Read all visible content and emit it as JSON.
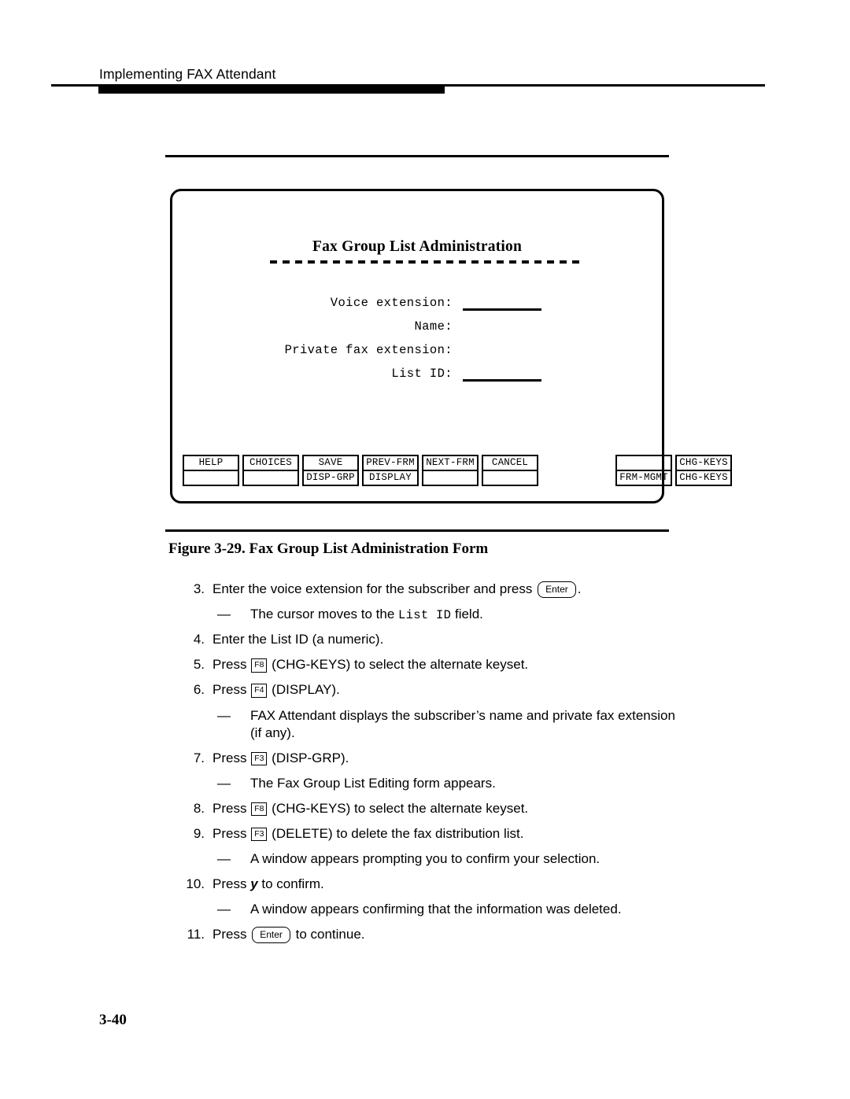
{
  "header": {
    "running_head": "Implementing FAX Attendant"
  },
  "figure": {
    "screen": {
      "title": "Fax Group List Administration",
      "fields": [
        {
          "label": "Voice extension:",
          "has_blank": true
        },
        {
          "label": "Name:",
          "has_blank": false
        },
        {
          "label": "Private fax extension:",
          "has_blank": false
        },
        {
          "label": "List ID:",
          "has_blank": true
        }
      ],
      "function_keys": [
        {
          "top": "HELP",
          "bottom": ""
        },
        {
          "top": "CHOICES",
          "bottom": ""
        },
        {
          "top": "SAVE",
          "bottom": "DISP-GRP"
        },
        {
          "top": "PREV-FRM",
          "bottom": "DISPLAY"
        },
        {
          "top": "NEXT-FRM",
          "bottom": ""
        },
        {
          "top": "CANCEL",
          "bottom": ""
        },
        {
          "top": "",
          "bottom": "FRM-MGMT"
        },
        {
          "top": "CHG-KEYS",
          "bottom": "CHG-KEYS"
        }
      ]
    },
    "caption": "Figure 3-29.  Fax Group List Administration Form"
  },
  "steps": [
    {
      "number": "3.",
      "parts": [
        {
          "type": "text",
          "value": "Enter the voice extension for the subscriber and press "
        },
        {
          "type": "key-enter",
          "value": "Enter"
        },
        {
          "type": "text",
          "value": "."
        }
      ]
    },
    {
      "number": "",
      "dash": "—",
      "parts": [
        {
          "type": "text",
          "value": "The cursor moves to the "
        },
        {
          "type": "mono",
          "value": "List ID"
        },
        {
          "type": "text",
          "value": " field."
        }
      ]
    },
    {
      "number": "4.",
      "parts": [
        {
          "type": "text",
          "value": "Enter the List ID (a numeric)."
        }
      ]
    },
    {
      "number": "5.",
      "parts": [
        {
          "type": "text",
          "value": "Press "
        },
        {
          "type": "key-fn",
          "value": "F8"
        },
        {
          "type": "text",
          "value": " (CHG-KEYS) to select the alternate keyset."
        }
      ]
    },
    {
      "number": "6.",
      "parts": [
        {
          "type": "text",
          "value": "Press "
        },
        {
          "type": "key-fn",
          "value": "F4"
        },
        {
          "type": "text",
          "value": " (DISPLAY)."
        }
      ]
    },
    {
      "number": "",
      "dash": "—",
      "parts": [
        {
          "type": "text",
          "value": "FAX Attendant displays the subscriber’s name and private fax extension (if any)."
        }
      ]
    },
    {
      "number": "7.",
      "parts": [
        {
          "type": "text",
          "value": "Press "
        },
        {
          "type": "key-fn",
          "value": "F3"
        },
        {
          "type": "text",
          "value": " (DISP-GRP)."
        }
      ]
    },
    {
      "number": "",
      "dash": "—",
      "parts": [
        {
          "type": "text",
          "value": "The Fax Group List Editing form appears."
        }
      ]
    },
    {
      "number": "8.",
      "parts": [
        {
          "type": "text",
          "value": "Press "
        },
        {
          "type": "key-fn",
          "value": "F8"
        },
        {
          "type": "text",
          "value": " (CHG-KEYS) to select the alternate keyset."
        }
      ]
    },
    {
      "number": "9.",
      "parts": [
        {
          "type": "text",
          "value": "Press "
        },
        {
          "type": "key-fn",
          "value": "F3"
        },
        {
          "type": "text",
          "value": " (DELETE) to delete the fax distribution list."
        }
      ]
    },
    {
      "number": "",
      "dash": "—",
      "parts": [
        {
          "type": "text",
          "value": "A window appears prompting you to confirm your selection."
        }
      ]
    },
    {
      "number": "10.",
      "parts": [
        {
          "type": "text",
          "value": "Press "
        },
        {
          "type": "bold-italic",
          "value": "y"
        },
        {
          "type": "text",
          "value": " to confirm."
        }
      ]
    },
    {
      "number": "",
      "dash": "—",
      "parts": [
        {
          "type": "text",
          "value": "A window appears confirming that the information was deleted."
        }
      ]
    },
    {
      "number": "11.",
      "parts": [
        {
          "type": "text",
          "value": "Press "
        },
        {
          "type": "key-enter",
          "value": "Enter"
        },
        {
          "type": "text",
          "value": " to continue."
        }
      ]
    }
  ],
  "footer": {
    "page_number": "3-40"
  }
}
